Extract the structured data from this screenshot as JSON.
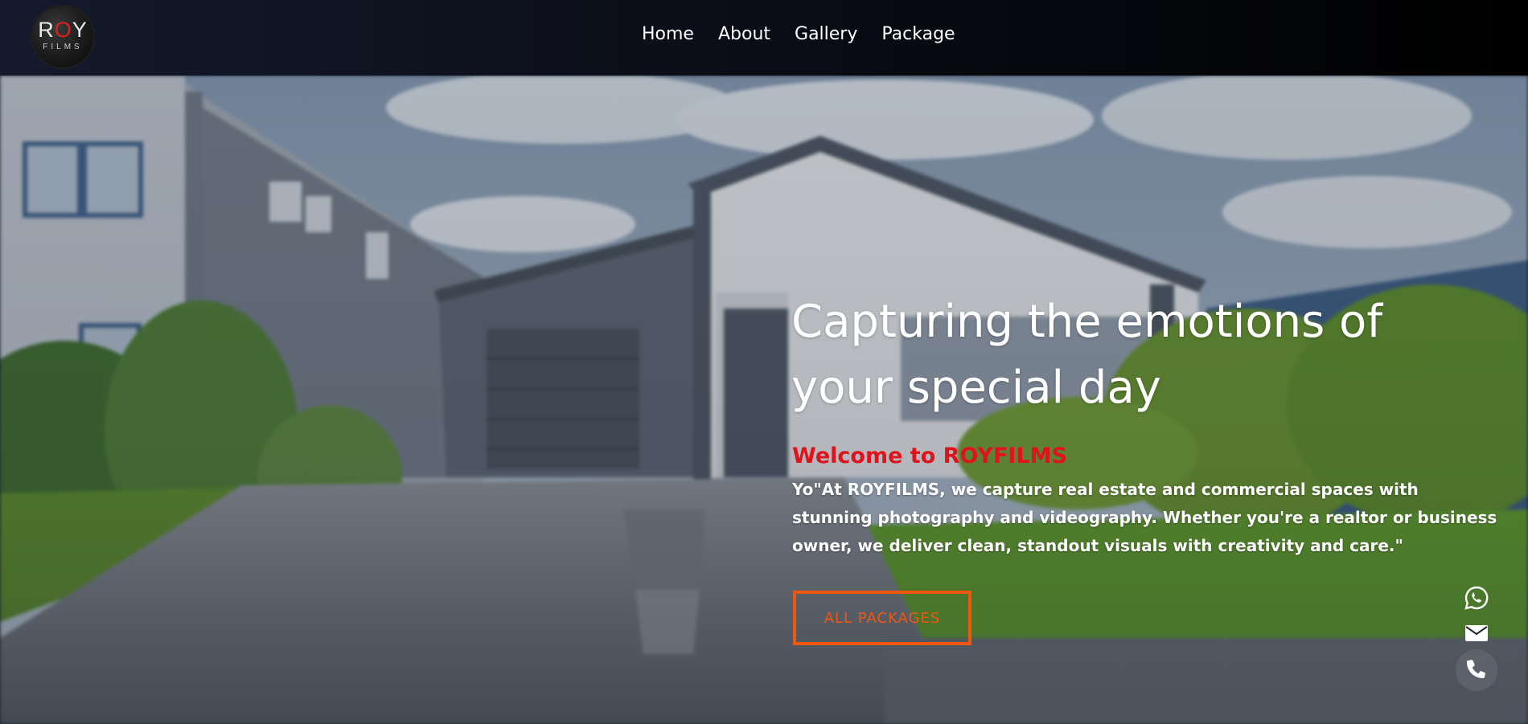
{
  "brand": {
    "logo_top": "ROY",
    "logo_bottom": "FILMS"
  },
  "nav": {
    "items": [
      "Home",
      "About",
      "Gallery",
      "Package"
    ]
  },
  "hero": {
    "headline_line1": "Capturing the emotions of",
    "headline_line2": "your special day",
    "welcome": "Welcome to ROYFILMS",
    "lead": "Yo\"At ROYFILMS, we capture real estate and commercial spaces with stunning photography and videography. Whether you're a realtor or business owner, we deliver clean, standout visuals with creativity and care.\"",
    "cta_label": "ALL PACKAGES"
  },
  "contact": {
    "icons": [
      "whatsapp-icon",
      "envelope-icon",
      "phone-icon"
    ]
  },
  "colors": {
    "accent_red": "#e0121b",
    "cta_orange": "#f1560f",
    "nav_bg": "#000000",
    "text": "#ffffff"
  }
}
